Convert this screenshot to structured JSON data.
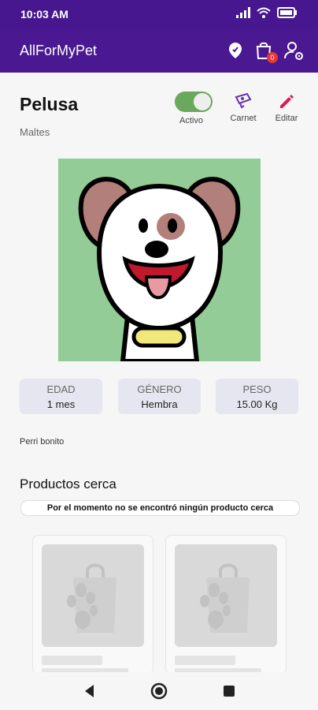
{
  "status": {
    "time": "10:03 AM"
  },
  "appbar": {
    "title": "AllForMyPet",
    "cart_count": "0"
  },
  "pet": {
    "name": "Pelusa",
    "breed": "Maltes",
    "toggle_label": "Activo",
    "carnet_label": "Carnet",
    "edit_label": "Editar",
    "stats": [
      {
        "label": "EDAD",
        "value": "1 mes"
      },
      {
        "label": "GÉNERO",
        "value": "Hembra"
      },
      {
        "label": "PESO",
        "value": "15.00 Kg"
      }
    ],
    "description": "Perri bonito"
  },
  "products": {
    "title": "Productos cerca",
    "notice": "Por el momento no se encontró ningún producto cerca"
  },
  "icons": {
    "location": "location-icon",
    "cart": "shopping-bag-icon",
    "profile": "user-settings-icon",
    "carnet": "id-card-icon",
    "edit": "pencil-icon"
  },
  "colors": {
    "brand": "#4a1992",
    "toggle_on": "#6aa95c",
    "badge": "#e53935",
    "edit": "#d81b60"
  }
}
